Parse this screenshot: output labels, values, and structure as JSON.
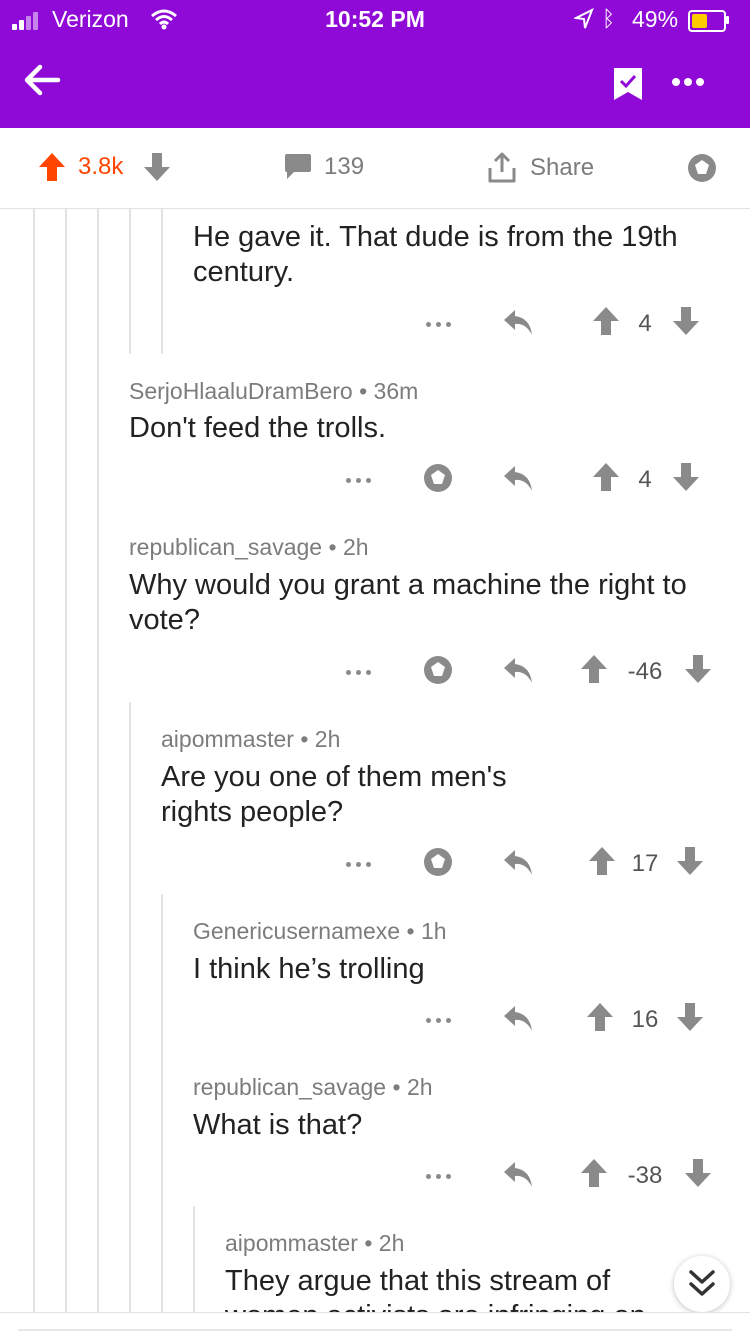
{
  "status_bar": {
    "carrier": "Verizon",
    "time": "10:52 PM",
    "battery": "49%",
    "battery_level": 0.49
  },
  "app_bar": {
    "back_icon": "arrow-left-icon",
    "save_icon": "bookmark-check-icon",
    "more_icon": "more-dots-icon",
    "accent": "#8f0ad6"
  },
  "post_actions": {
    "score": "3.8k",
    "comments": "139",
    "share_label": "Share",
    "upvote_color": "#ff4500"
  },
  "comments": [
    {
      "author": "",
      "age": "",
      "text": "He gave it. That dude is from the 19th century.",
      "score": "4",
      "has_award": false
    },
    {
      "author": "SerjoHlaaluDramBero",
      "age": "36m",
      "text": "Don't feed the trolls.",
      "score": "4",
      "has_award": true
    },
    {
      "author": "republican_savage",
      "age": "2h",
      "text": "Why would you grant a machine the right to vote?",
      "score": "-46",
      "has_award": true
    },
    {
      "author": "aipommaster",
      "age": "2h",
      "text": "Are you one of them men's rights people?",
      "score": "17",
      "has_award": true
    },
    {
      "author": "Genericusernamexe",
      "age": "1h",
      "text": "I think he’s trolling",
      "score": "16",
      "has_award": false
    },
    {
      "author": "republican_savage",
      "age": "2h",
      "text": "What is that?",
      "score": "-38",
      "has_award": false
    },
    {
      "author": "aipommaster",
      "age": "2h",
      "text": "They argue that this stream of women activists are infringing on",
      "score": "",
      "has_award": false
    }
  ],
  "separator": "•",
  "jump_icon": "chevron-double-down-icon"
}
